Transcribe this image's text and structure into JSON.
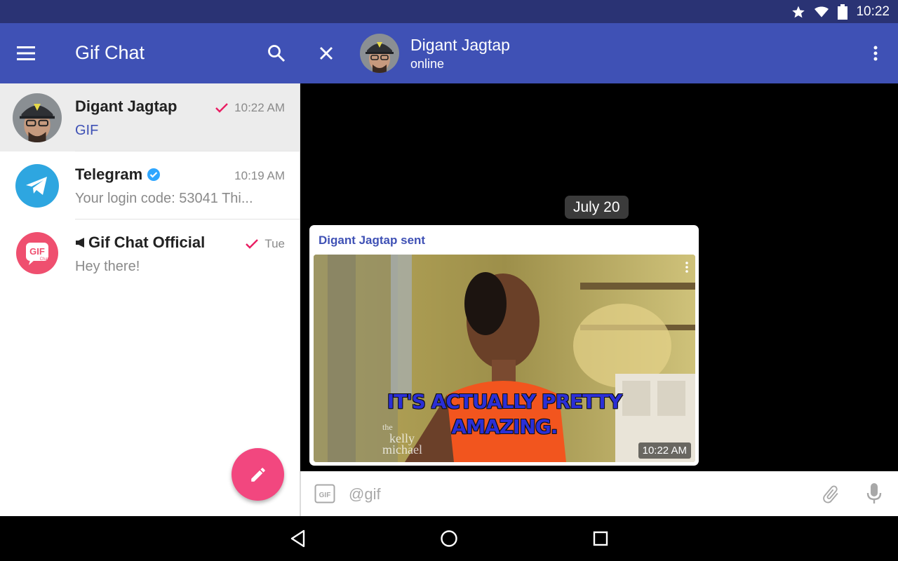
{
  "status_bar": {
    "time": "10:22",
    "icons": [
      "star-icon",
      "wifi-icon",
      "battery-icon"
    ]
  },
  "left_toolbar": {
    "title": "Gif Chat",
    "icons": [
      "menu-icon",
      "search-icon"
    ]
  },
  "chat_header": {
    "name": "Digant Jagtap",
    "status": "online",
    "icons": [
      "close-icon",
      "more-vert-icon"
    ]
  },
  "chats": [
    {
      "name": "Digant Jagtap",
      "preview": "GIF",
      "time": "10:22 AM",
      "read_check": true,
      "active": true
    },
    {
      "name": "Telegram",
      "preview": "Your login code: 53041  Thi...",
      "time": "10:19 AM",
      "verified": true
    },
    {
      "name": "Gif Chat Official",
      "preview": "Hey there!",
      "time": "Tue",
      "read_check": true,
      "channel": true,
      "avatar_text": "GIF",
      "avatar_subtext": "Chat"
    }
  ],
  "conversation": {
    "date": "July 20",
    "message": {
      "sender_line": "Digant Jagtap sent",
      "gif_caption_1": "IT'S ACTUALLY PRETTY",
      "gif_caption_2": "AMAZING.",
      "gif_watermark_1": "the",
      "gif_watermark_2": "kelly",
      "gif_watermark_3": "michael",
      "time": "10:22 AM"
    }
  },
  "composer": {
    "placeholder": "@gif",
    "gif_button": "GIF",
    "icons": [
      "attach-icon",
      "mic-icon"
    ]
  },
  "colors": {
    "primary": "#3f51b5",
    "statusbar": "#2a3374",
    "accent": "#f2477f",
    "check": "#e91e63",
    "verified": "#2ea6ff"
  },
  "nav_bar": {
    "icons": [
      "back-icon",
      "home-icon",
      "recents-icon"
    ]
  }
}
